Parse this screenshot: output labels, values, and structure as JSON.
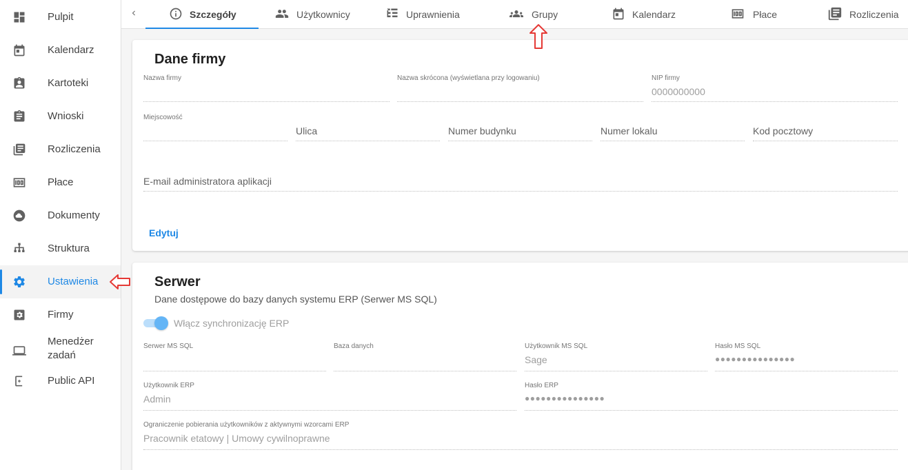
{
  "sidebar": {
    "items": [
      {
        "label": "Pulpit",
        "icon": "dashboard-icon"
      },
      {
        "label": "Kalendarz",
        "icon": "calendar-icon"
      },
      {
        "label": "Kartoteki",
        "icon": "person-badge-icon"
      },
      {
        "label": "Wnioski",
        "icon": "clipboard-icon"
      },
      {
        "label": "Rozliczenia",
        "icon": "library-books-icon"
      },
      {
        "label": "Płace",
        "icon": "money-icon"
      },
      {
        "label": "Dokumenty",
        "icon": "cloud-icon"
      },
      {
        "label": "Struktura",
        "icon": "org-structure-icon"
      },
      {
        "label": "Ustawienia",
        "icon": "gear-icon",
        "active": true
      },
      {
        "label": "Firmy",
        "icon": "settings-box-icon"
      },
      {
        "label1": "Menedżer",
        "label2": "zadań",
        "icon": "laptop-icon"
      },
      {
        "label": "Public API",
        "icon": "api-icon"
      }
    ]
  },
  "tabs": {
    "items": [
      {
        "label": "Szczegóły",
        "icon": "info-icon",
        "active": true
      },
      {
        "label": "Użytkownicy",
        "icon": "users-icon"
      },
      {
        "label": "Uprawnienia",
        "icon": "hierarchy-icon"
      },
      {
        "label": "Grupy",
        "icon": "groups-icon"
      },
      {
        "label": "Kalendarz",
        "icon": "calendar-icon"
      },
      {
        "label": "Płace",
        "icon": "money-icon"
      },
      {
        "label": "Rozliczenia",
        "icon": "library-books-icon"
      }
    ]
  },
  "company": {
    "title": "Dane firmy",
    "name_label": "Nazwa firmy",
    "short_name_label": "Nazwa skrócona (wyświetlana przy logowaniu)",
    "nip_label": "NIP firmy",
    "nip_value": "0000000000",
    "city_label": "Miejscowość",
    "street_placeholder": "Ulica",
    "building_placeholder": "Numer budynku",
    "apartment_placeholder": "Numer lokalu",
    "postcode_placeholder": "Kod pocztowy",
    "admin_email_placeholder": "E-mail administratora aplikacji",
    "edit_label": "Edytuj"
  },
  "server": {
    "title": "Serwer",
    "subtitle": "Dane dostępowe do bazy danych systemu ERP (Serwer MS SQL)",
    "sync_toggle_label": "Włącz synchronizację ERP",
    "sync_enabled": true,
    "mssql_server_label": "Serwer MS SQL",
    "database_label": "Baza danych",
    "mssql_user_label": "Użytkownik MS SQL",
    "mssql_user_value": "Sage",
    "mssql_password_label": "Hasło MS SQL",
    "mssql_password_value": "●●●●●●●●●●●●●●●",
    "erp_user_label": "Użytkownik ERP",
    "erp_user_value": "Admin",
    "erp_password_label": "Hasło ERP",
    "erp_password_value": "●●●●●●●●●●●●●●●",
    "restriction_label": "Ograniczenie pobierania użytkowników z aktywnymi wzorcami ERP",
    "restriction_value": "Pracownik etatowy | Umowy cywilnoprawne"
  },
  "colors": {
    "accent": "#1e88e5",
    "annotation": "#e53935"
  }
}
